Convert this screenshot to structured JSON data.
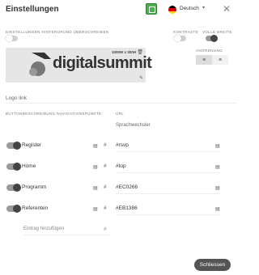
{
  "header": {
    "title": "Einstellungen",
    "language": "Deutsch"
  },
  "settings": {
    "overwrite_bg_label": "Einstellungen Hintergrund überschreiben",
    "overwrite_bg_on": false,
    "contrast_label": "Kontraste",
    "contrast_on": false,
    "full_width_label": "Volle Breite",
    "full_width_on": true,
    "alignment_label": "Anordnung",
    "alignment_selected": "left"
  },
  "image": {
    "size_text": "1000W x 300H",
    "logo_text": "digitalsummit"
  },
  "logo_link_placeholder": "Logo link",
  "columns": {
    "nav_label": "Buttonbeschreibung Navigationspunkte",
    "url": "URL"
  },
  "sprachwechsler": "Sprachwechsler",
  "nav_items": [
    {
      "label": "Register",
      "url": "#rsvp",
      "enabled": true
    },
    {
      "label": "Home",
      "url": "#top",
      "enabled": true
    },
    {
      "label": "Programm",
      "url": "#EC0266",
      "enabled": true
    },
    {
      "label": "Referenten",
      "url": "#EB1386",
      "enabled": true
    }
  ],
  "add_entry_placeholder": "Eintrag hinzufügen",
  "hash_symbol": "#",
  "close_button_label": "Schliessen",
  "colors": {
    "lang_badge": "#4caf50",
    "button_dark": "#555555"
  }
}
